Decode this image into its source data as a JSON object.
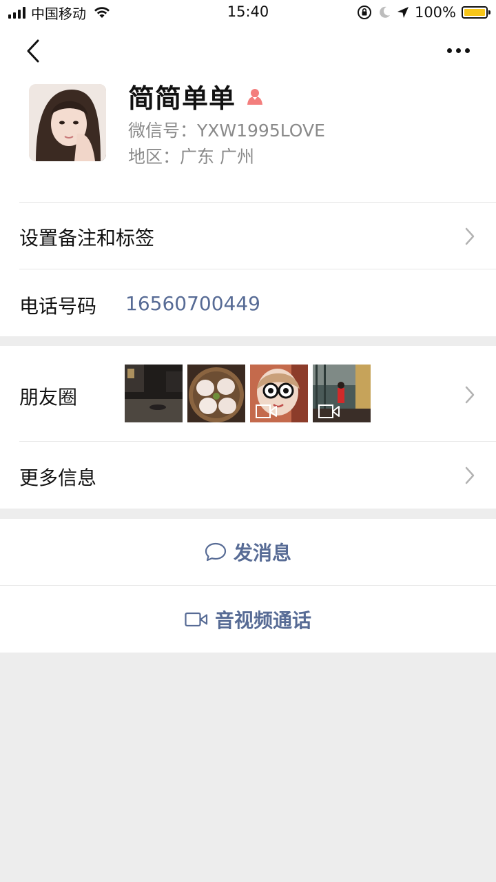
{
  "status_bar": {
    "carrier": "中国移动",
    "time": "15:40",
    "battery_pct": "100%",
    "battery_level": 1.0,
    "battery_color": "#f7c619"
  },
  "profile": {
    "name": "简简单单",
    "gender_icon": "female-icon",
    "wechat_id": "微信号：YXW1995LOVE",
    "region": "地区：广东 广州"
  },
  "rows": {
    "remark_label": "设置备注和标签",
    "phone_label": "电话号码",
    "phone_value": "16560700449",
    "moments_label": "朋友圈",
    "more_info_label": "更多信息"
  },
  "actions": {
    "message_label": "发消息",
    "call_label": "音视频通话"
  },
  "colors": {
    "link": "#576b95",
    "background": "#ededed",
    "gender": "#f37e7d"
  }
}
